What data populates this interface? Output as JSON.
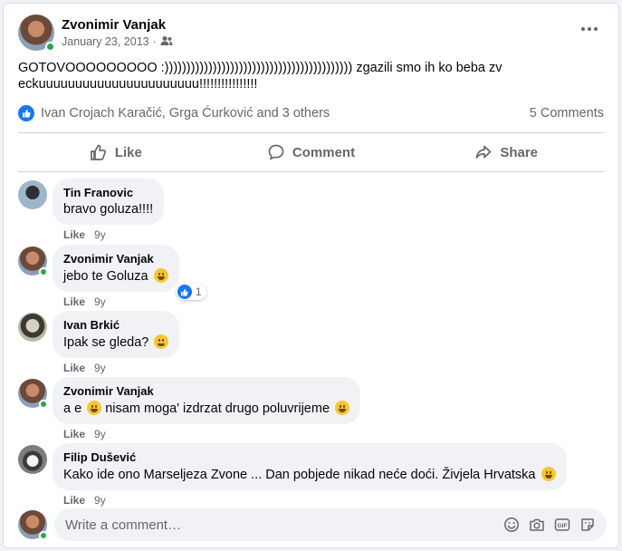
{
  "post": {
    "author": "Zvonimir Vanjak",
    "date": "January 23, 2013",
    "audience_icon": "friends-icon",
    "text": "GOTOVOOOOOOOOO :))))))))))))))))))))))))))))))))))))))))))) zgazili smo ih ko beba zveckuuuuuuuuuuuuuuuuuuuuuu!!!!!!!!!!!!!!!!",
    "reactions_text": "Ivan Crojach Karačić, Grga Ćurković and 3 others",
    "comments_count": "5 Comments"
  },
  "actions": {
    "like": "Like",
    "comment": "Comment",
    "share": "Share"
  },
  "comments": [
    {
      "author": "Tin Franovic",
      "text": "bravo goluza!!!!",
      "emoji": "",
      "like": "Like",
      "time": "9y"
    },
    {
      "author": "Zvonimir Vanjak",
      "text": "jebo te Goluza",
      "emoji": "grinning",
      "like": "Like",
      "time": "9y",
      "reaction_count": "1"
    },
    {
      "author": "Ivan Brkić",
      "text": "Ipak se gleda?",
      "emoji": "smiling",
      "like": "Like",
      "time": "9y"
    },
    {
      "author": "Zvonimir Vanjak",
      "text_before": "a e",
      "text_after": "nisam moga' izdrzat drugo poluvrijeme",
      "like": "Like",
      "time": "9y"
    },
    {
      "author": "Filip Dušević",
      "text": "Kako ide ono Marseljeza Zvone ... Dan pobjede nikad neće doći. Živjela Hrvatska",
      "like": "Like",
      "time": "9y"
    }
  ],
  "composer": {
    "placeholder": "Write a comment…"
  },
  "colors": {
    "accent": "#1877f2",
    "online": "#31a24c"
  }
}
